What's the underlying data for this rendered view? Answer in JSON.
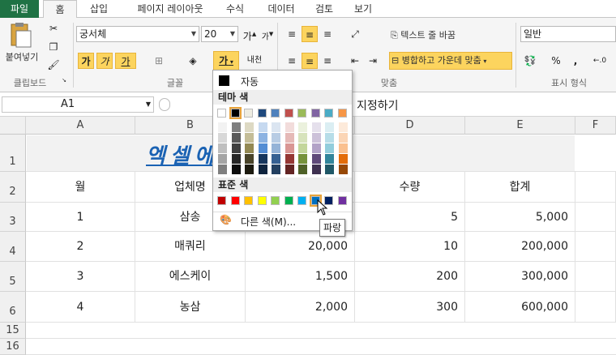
{
  "tabs": [
    "파일",
    "홈",
    "삽입",
    "페이지 레이아웃",
    "수식",
    "데이터",
    "검토",
    "보기"
  ],
  "ribbon": {
    "paste_label": "붙여넣기",
    "font_name": "궁서체",
    "font_size": "20",
    "bold": "가",
    "italic": "가",
    "underline": "가",
    "font_color_glyph": "가",
    "wrap_text": "텍스트 줄 바꿈",
    "merge_center": "병합하고 가운데 맞춤",
    "number_format": "일반",
    "percent": "%",
    "comma": ",",
    "groups": {
      "clipboard": "클립보드",
      "font": "글꼴",
      "align": "맞춤",
      "number": "표시 형식"
    }
  },
  "formula_bar": {
    "name_box": "A1",
    "text": "지정하기"
  },
  "columns": [
    "A",
    "B",
    "C",
    "D",
    "E",
    "F"
  ],
  "rows": [
    "1",
    "2",
    "3",
    "4",
    "5",
    "6",
    "15",
    "16"
  ],
  "title_text": "엑셀에 지정하기",
  "table": {
    "headers": [
      "월",
      "업체명",
      "",
      "수량",
      "합계"
    ],
    "rows": [
      [
        "1",
        "삼송",
        "",
        "5",
        "5,000"
      ],
      [
        "2",
        "매쿼리",
        "20,000",
        "10",
        "200,000"
      ],
      [
        "3",
        "에스케이",
        "1,500",
        "200",
        "300,000"
      ],
      [
        "4",
        "농삼",
        "2,000",
        "300",
        "600,000"
      ]
    ]
  },
  "color_menu": {
    "auto_label": "자동",
    "theme_label": "테마 색",
    "standard_label": "표준 색",
    "more_label": "다른 색(M)...",
    "tooltip": "파랑",
    "theme_colors": [
      "#ffffff",
      "#000000",
      "#eeece1",
      "#1f497d",
      "#4f81bd",
      "#c0504d",
      "#9bbb59",
      "#8064a2",
      "#4bacc6",
      "#f79646"
    ],
    "standard_colors": [
      "#c00000",
      "#ff0000",
      "#ffc000",
      "#ffff00",
      "#92d050",
      "#00b050",
      "#00b0f0",
      "#0070c0",
      "#002060",
      "#7030a0"
    ]
  }
}
